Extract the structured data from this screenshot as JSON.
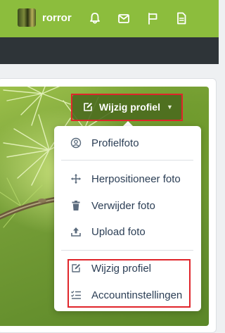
{
  "topbar": {
    "username": "rorror",
    "icons": [
      "bell-icon",
      "mail-icon",
      "flag-icon",
      "document-icon"
    ],
    "bg_color": "#8cbd3d"
  },
  "profile": {
    "edit_button_label": "Wijzig profiel"
  },
  "dropdown": {
    "items": [
      {
        "label": "Profielfoto",
        "icon": "user-circle-icon"
      },
      {
        "label": "Herpositioneer foto",
        "icon": "move-icon"
      },
      {
        "label": "Verwijder foto",
        "icon": "trash-icon"
      },
      {
        "label": "Upload foto",
        "icon": "upload-icon"
      },
      {
        "label": "Wijzig profiel",
        "icon": "edit-icon"
      },
      {
        "label": "Accountinstellingen",
        "icon": "checklist-icon"
      }
    ]
  },
  "colors": {
    "highlight": "#e0252b",
    "menu_text": "#2b3e55"
  }
}
